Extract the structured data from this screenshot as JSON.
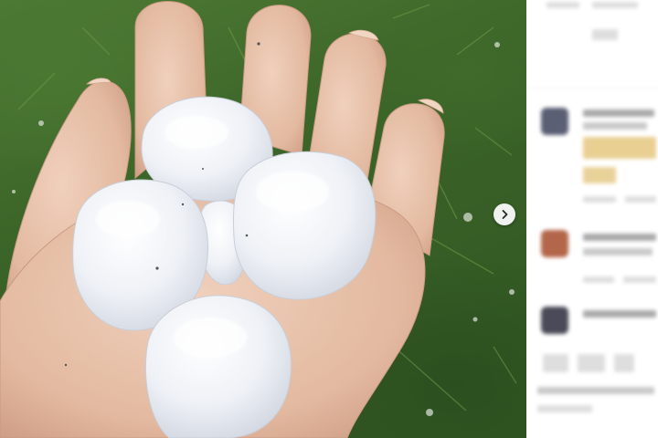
{
  "photo": {
    "subject": "hand-holding-hailstones-icon",
    "next_icon": "chevron-right-icon"
  },
  "comments_panel": {
    "blurred": true,
    "comment_count": 5
  },
  "colors": {
    "grass": "#3b6428",
    "skin": "#e8c4ae",
    "hail": "#f4f5f8",
    "panel": "#ffffff"
  }
}
